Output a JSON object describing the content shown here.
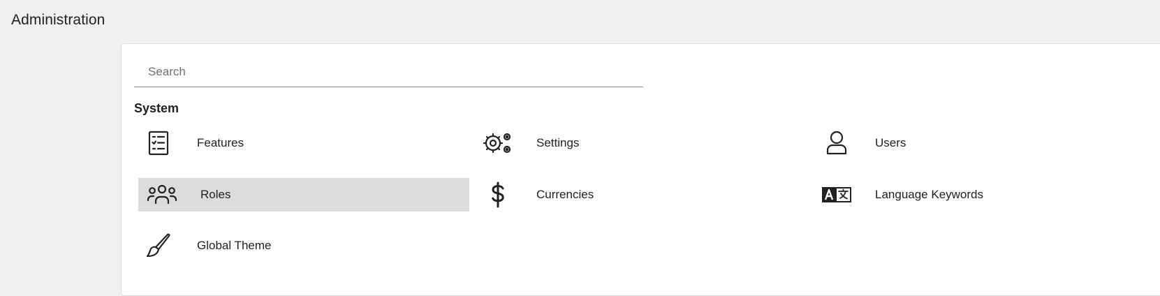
{
  "header": {
    "title": "Administration"
  },
  "search": {
    "placeholder": "Search",
    "value": ""
  },
  "section": {
    "title": "System",
    "items": [
      {
        "label": "Features",
        "icon": "checklist-icon"
      },
      {
        "label": "Settings",
        "icon": "gears-icon"
      },
      {
        "label": "Users",
        "icon": "user-icon"
      },
      {
        "label": "Roles",
        "icon": "users-group-icon",
        "selected": true
      },
      {
        "label": "Currencies",
        "icon": "dollar-icon"
      },
      {
        "label": "Language Keywords",
        "icon": "language-icon"
      },
      {
        "label": "Global Theme",
        "icon": "brush-icon"
      }
    ]
  },
  "colors": {
    "background": "#f0f0f0",
    "card": "#ffffff",
    "selected": "#dcdcdc"
  }
}
